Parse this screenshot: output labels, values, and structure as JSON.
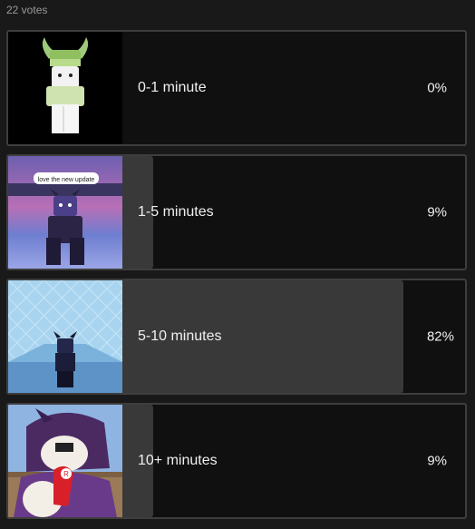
{
  "poll": {
    "votes_text": "22 votes",
    "options": [
      {
        "label": "0-1 minute",
        "percent_text": "0%",
        "percent": 0,
        "thumbnail_icon": "avatar-image-green-hat"
      },
      {
        "label": "1-5 minutes",
        "percent_text": "9%",
        "percent": 9,
        "thumbnail_icon": "avatar-image-speech-bubble",
        "thumb_caption": "love the new update"
      },
      {
        "label": "5-10 minutes",
        "percent_text": "82%",
        "percent": 82,
        "thumbnail_icon": "avatar-image-ice-room"
      },
      {
        "label": "10+ minutes",
        "percent_text": "9%",
        "percent": 9,
        "thumbnail_icon": "avatar-image-purple-hood"
      }
    ]
  }
}
